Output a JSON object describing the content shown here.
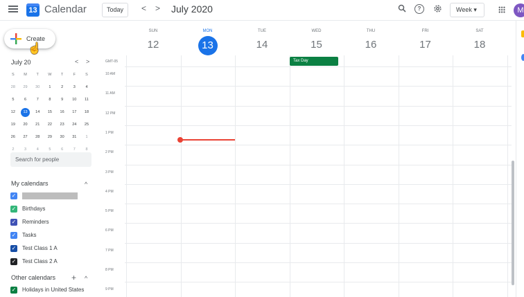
{
  "header": {
    "app_title": "Calendar",
    "logo_day": "13",
    "today_label": "Today",
    "prev_label": "<",
    "next_label": ">",
    "month_title": "July 2020",
    "view_label": "Week ▾",
    "avatar_letter": "M"
  },
  "create": {
    "label": "Create"
  },
  "mini_calendar": {
    "title": "July 20",
    "prev": "<",
    "next": ">",
    "weekdays": [
      "S",
      "M",
      "T",
      "W",
      "T",
      "F",
      "S"
    ],
    "weeks": [
      [
        "28",
        "29",
        "30",
        "1",
        "2",
        "3",
        "4"
      ],
      [
        "5",
        "6",
        "7",
        "8",
        "9",
        "10",
        "11"
      ],
      [
        "12",
        "13",
        "14",
        "15",
        "16",
        "17",
        "18"
      ],
      [
        "19",
        "20",
        "21",
        "22",
        "23",
        "24",
        "25"
      ],
      [
        "26",
        "27",
        "28",
        "29",
        "30",
        "31",
        "1"
      ],
      [
        "2",
        "3",
        "4",
        "5",
        "6",
        "7",
        "8"
      ]
    ]
  },
  "search_people": {
    "placeholder": "Search for people"
  },
  "my_calendars": {
    "title": "My calendars",
    "chevron": "^",
    "items": [
      {
        "label": "",
        "color": "#4285f4"
      },
      {
        "label": "Birthdays",
        "color": "#33b679"
      },
      {
        "label": "Reminders",
        "color": "#3f51b5"
      },
      {
        "label": "Tasks",
        "color": "#4285f4"
      },
      {
        "label": "Test Class 1 A",
        "color": "#174ea6"
      },
      {
        "label": "Test Class 2 A",
        "color": "#202124"
      }
    ]
  },
  "other_calendars": {
    "title": "Other calendars",
    "add": "+",
    "chevron": "^",
    "items": [
      {
        "label": "Holidays in United States",
        "color": "#0b8043"
      }
    ]
  },
  "week": {
    "timezone": "GMT-05",
    "days": [
      {
        "dow": "SUN",
        "num": "12"
      },
      {
        "dow": "MON",
        "num": "13"
      },
      {
        "dow": "TUE",
        "num": "14"
      },
      {
        "dow": "WED",
        "num": "15"
      },
      {
        "dow": "THU",
        "num": "16"
      },
      {
        "dow": "FRI",
        "num": "17"
      },
      {
        "dow": "SAT",
        "num": "18"
      }
    ],
    "times": [
      "10 AM",
      "11 AM",
      "12 PM",
      "1 PM",
      "2 PM",
      "3 PM",
      "4 PM",
      "5 PM",
      "6 PM",
      "7 PM",
      "8 PM",
      "9 PM"
    ],
    "events": [
      {
        "title": "Tax Day",
        "day": "WED",
        "all_day": true,
        "color": "#0b8043"
      }
    ]
  },
  "colors": {
    "accent": "#1a73e8",
    "now_indicator": "#ea4335"
  }
}
